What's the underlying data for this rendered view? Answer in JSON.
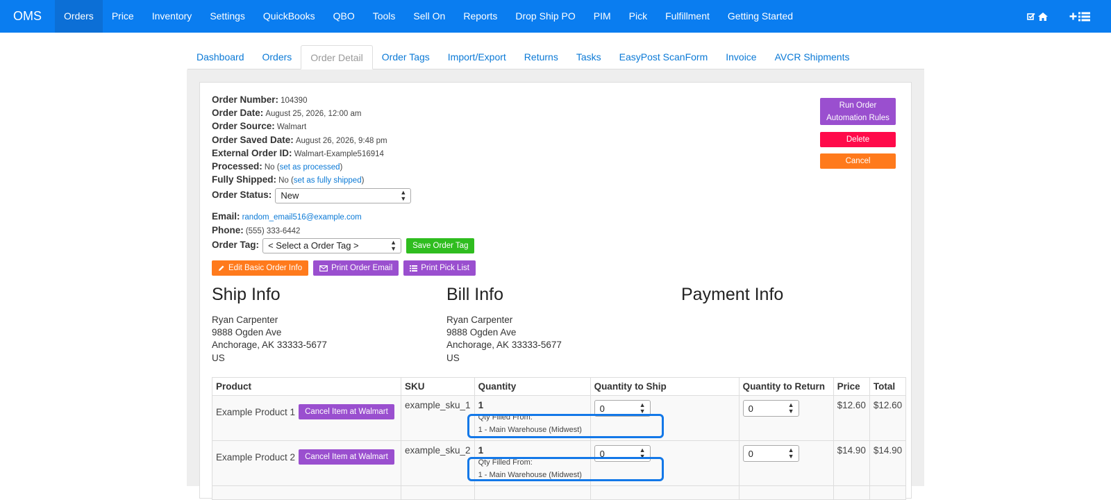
{
  "nav": {
    "brand": "OMS",
    "items": [
      "Orders",
      "Price",
      "Inventory",
      "Settings",
      "QuickBooks",
      "QBO",
      "Tools",
      "Sell On",
      "Reports",
      "Drop Ship PO",
      "PIM",
      "Pick",
      "Fulfillment",
      "Getting Started"
    ],
    "active": "Orders",
    "icons": [
      "check-square-icon",
      "home-icon",
      "plus-icon",
      "list-icon"
    ]
  },
  "tabs": {
    "items": [
      "Dashboard",
      "Orders",
      "Order Detail",
      "Order Tags",
      "Import/Export",
      "Returns",
      "Tasks",
      "EasyPost ScanForm",
      "Invoice",
      "AVCR Shipments"
    ],
    "active": "Order Detail"
  },
  "order": {
    "number_label": "Order Number:",
    "number": "104390",
    "date_label": "Order Date:",
    "date": "August 25, 2026, 12:00 am",
    "source_label": "Order Source:",
    "source": "Walmart",
    "saved_label": "Order Saved Date:",
    "saved": "August 26, 2026, 9:48 pm",
    "external_label": "External Order ID:",
    "external": "Walmart-Example516914",
    "processed_label": "Processed:",
    "processed": "No (",
    "processed_link": "set as processed",
    "processed_close": ")",
    "shipped_label": "Fully Shipped:",
    "shipped": "No (",
    "shipped_link": "set as fully shipped",
    "shipped_close": ")",
    "status_label": "Order Status:",
    "status": "New",
    "email_label": "Email:",
    "email": "random_email516@example.com",
    "phone_label": "Phone:",
    "phone": "(555) 333-6442",
    "tag_label": "Order Tag:",
    "tag_placeholder": "< Select a Order Tag >",
    "save_tag": "Save Order Tag"
  },
  "right_buttons": {
    "run_rules": "Run Order Automation Rules",
    "delete": "Delete",
    "cancel": "Cancel"
  },
  "actions": {
    "edit": "Edit Basic Order Info",
    "print_email": "Print Order Email",
    "print_pick": "Print Pick List"
  },
  "ship": {
    "title": "Ship Info",
    "name": "Ryan Carpenter",
    "street": "9888 Ogden Ave",
    "city": "Anchorage, AK 33333-5677",
    "country": "US"
  },
  "bill": {
    "title": "Bill Info",
    "name": "Ryan Carpenter",
    "street": "9888 Ogden Ave",
    "city": "Anchorage, AK 33333-5677",
    "country": "US"
  },
  "payment": {
    "title": "Payment Info"
  },
  "table": {
    "headers": [
      "Product",
      "SKU",
      "Quantity",
      "Quantity to Ship",
      "Quantity to Return",
      "Price",
      "Total"
    ],
    "rows": [
      {
        "product": "Example Product 1",
        "cancel": "Cancel Item at Walmart",
        "sku": "example_sku_1",
        "qty": "1",
        "filled_label": "Qty Filled From:",
        "filled_from": "1 - Main Warehouse (Midwest)",
        "ship": "0",
        "return": "0",
        "price": "$12.60",
        "total": "$12.60"
      },
      {
        "product": "Example Product 2",
        "cancel": "Cancel Item at Walmart",
        "sku": "example_sku_2",
        "qty": "1",
        "filled_label": "Qty Filled From:",
        "filled_from": "1 - Main Warehouse (Midwest)",
        "ship": "0",
        "return": "0",
        "price": "$14.90",
        "total": "$14.90"
      }
    ]
  },
  "colors": {
    "navbar": "#0a7df0",
    "link": "#0a79d6",
    "green": "#2fbd1f",
    "orange": "#ff7a1c",
    "purple": "#9a4fcf",
    "red": "#ff0a4a",
    "highlight": "#1378e8"
  }
}
